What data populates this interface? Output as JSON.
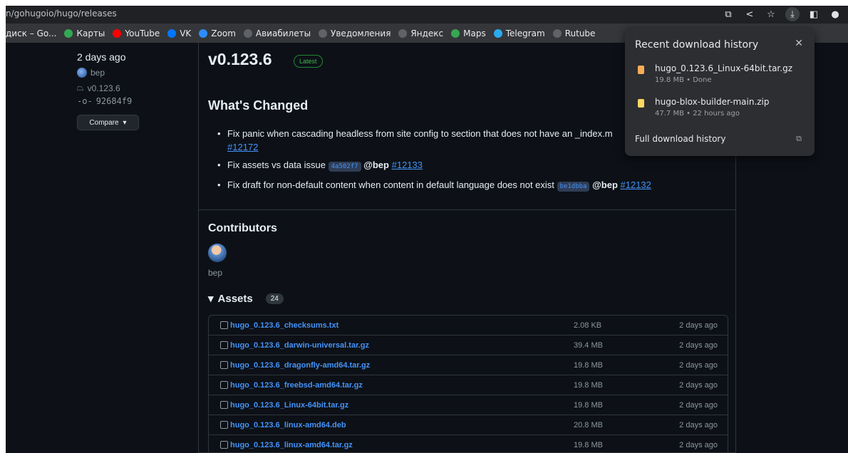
{
  "browser": {
    "url": "n/gohugoio/hugo/releases",
    "bookmarks": [
      {
        "label": "диск – Go...",
        "color": ""
      },
      {
        "label": "Карты",
        "color": "#34a853"
      },
      {
        "label": "YouTube",
        "color": "#ff0000"
      },
      {
        "label": "VK",
        "color": "#0077ff"
      },
      {
        "label": "Zoom",
        "color": "#2d8cff"
      },
      {
        "label": "Авиабилеты",
        "color": "#5f6368"
      },
      {
        "label": "Уведомления",
        "color": "#5f6368"
      },
      {
        "label": "Яндекс",
        "color": "#5f6368"
      },
      {
        "label": "Maps",
        "color": "#34a853"
      },
      {
        "label": "Telegram",
        "color": "#2aabee"
      },
      {
        "label": "Rutube",
        "color": "#5f6368"
      }
    ]
  },
  "sidebar": {
    "date": "2 days ago",
    "author": "bep",
    "tag": "v0.123.6",
    "commit": "92684f9",
    "compare_label": "Compare"
  },
  "release": {
    "title": "v0.123.6",
    "badge": "Latest",
    "changes_heading": "What's Changed",
    "changes": [
      {
        "text": "Fix panic when cascading headless from site config to section that does not have an _index.m",
        "sha": "",
        "mention": "",
        "issue": "#12172"
      },
      {
        "text": "Fix assets vs data issue",
        "sha": "4a502f7",
        "mention": "@bep",
        "issue": "#12133"
      },
      {
        "text": "Fix draft for non-default content when content in default language does not exist",
        "sha": "be1dbba",
        "mention": "@bep",
        "issue": "#12132"
      }
    ],
    "contributors_heading": "Contributors",
    "contributor": "bep",
    "assets_heading": "Assets",
    "assets_count": "24",
    "assets": [
      {
        "name": "hugo_0.123.6_checksums.txt",
        "size": "2.08 KB",
        "date": "2 days ago"
      },
      {
        "name": "hugo_0.123.6_darwin-universal.tar.gz",
        "size": "39.4 MB",
        "date": "2 days ago"
      },
      {
        "name": "hugo_0.123.6_dragonfly-amd64.tar.gz",
        "size": "19.8 MB",
        "date": "2 days ago"
      },
      {
        "name": "hugo_0.123.6_freebsd-amd64.tar.gz",
        "size": "19.8 MB",
        "date": "2 days ago"
      },
      {
        "name": "hugo_0.123.6_Linux-64bit.tar.gz",
        "size": "19.8 MB",
        "date": "2 days ago"
      },
      {
        "name": "hugo_0.123.6_linux-amd64.deb",
        "size": "20.8 MB",
        "date": "2 days ago"
      },
      {
        "name": "hugo_0.123.6_linux-amd64.tar.gz",
        "size": "19.8 MB",
        "date": "2 days ago"
      }
    ]
  },
  "downloads": {
    "title": "Recent download history",
    "items": [
      {
        "name": "hugo_0.123.6_Linux-64bit.tar.gz",
        "meta": "19.8 MB • Done",
        "color": "#f6ad55"
      },
      {
        "name": "hugo-blox-builder-main.zip",
        "meta": "47.7 MB • 22 hours ago",
        "color": "#fdd663"
      }
    ],
    "full_history": "Full download history"
  }
}
